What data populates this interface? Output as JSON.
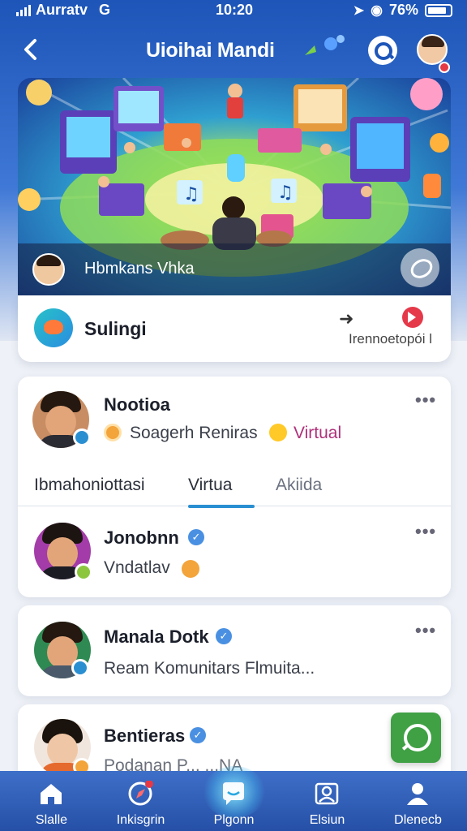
{
  "status_bar": {
    "carrier": "Aurratv",
    "network": "G",
    "time": "10:20",
    "battery": "76%"
  },
  "header": {
    "title": "Uioihai Mandi"
  },
  "hero": {
    "caption": "Hbmkans Vhka"
  },
  "sub_card": {
    "title": "Sulingi",
    "link": "Irennoetopói l"
  },
  "featured_post": {
    "name": "Nootioa",
    "subtitle": "Soagerh Reniras",
    "tag": "Virtual",
    "tabs": [
      {
        "label": "Ibmahoniottasi"
      },
      {
        "label": "Virtua"
      },
      {
        "label": "Akiida"
      }
    ],
    "reply_name": "Jonobnn",
    "reply_text": "Vndatlav"
  },
  "posts": [
    {
      "name": "Manala Dotk",
      "text": "Ream Komunitars Flmuita..."
    },
    {
      "name": "Bentieras",
      "text": "Podanan P...  ...NA"
    }
  ],
  "bottom_nav": [
    {
      "label": "Slalle",
      "icon": "home-icon"
    },
    {
      "label": "Inkisgrin",
      "icon": "compass-icon"
    },
    {
      "label": "Plgonn",
      "icon": "chat-icon"
    },
    {
      "label": "Elsiun",
      "icon": "community-icon"
    },
    {
      "label": "Dlenecb",
      "icon": "profile-icon"
    }
  ],
  "colors": {
    "header_blue": "#1d55b8",
    "accent_teal": "#2a8fd1",
    "tag_purple": "#b0307a",
    "fab_green": "#3fa044",
    "alert_red": "#e53946"
  }
}
